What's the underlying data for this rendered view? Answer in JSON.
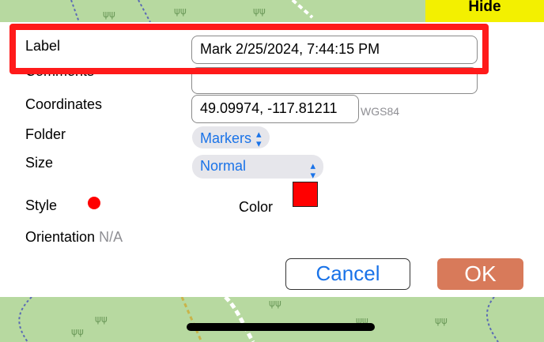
{
  "top_bar": {
    "hide_label": "Hide"
  },
  "form": {
    "label_caption": "Label",
    "label_value": "Mark 2/25/2024, 7:44:15 PM",
    "comments_caption": "Comments",
    "comments_value": "",
    "coordinates_caption": "Coordinates",
    "coordinates_value": "49.09974, -117.81211",
    "coordinates_datum": "WGS84",
    "folder_caption": "Folder",
    "folder_value": "Markers",
    "size_caption": "Size",
    "size_value": "Normal",
    "style_caption": "Style",
    "color_caption": "Color",
    "orientation_caption": "Orientation",
    "orientation_value": "N/A"
  },
  "buttons": {
    "cancel": "Cancel",
    "ok": "OK"
  },
  "colors": {
    "style_dot": "#ff0000",
    "color_swatch": "#ff0000",
    "accent": "#1a73e8",
    "ok_background": "#d87a5a",
    "hide_background": "#f3f000",
    "highlight": "#ff1a1a",
    "map_green": "#b7d9a0"
  },
  "icons": {
    "folder_chevron": "up-down-chevron-icon",
    "size_chevron": "up-down-chevron-icon",
    "style_marker": "red-dot-icon"
  }
}
